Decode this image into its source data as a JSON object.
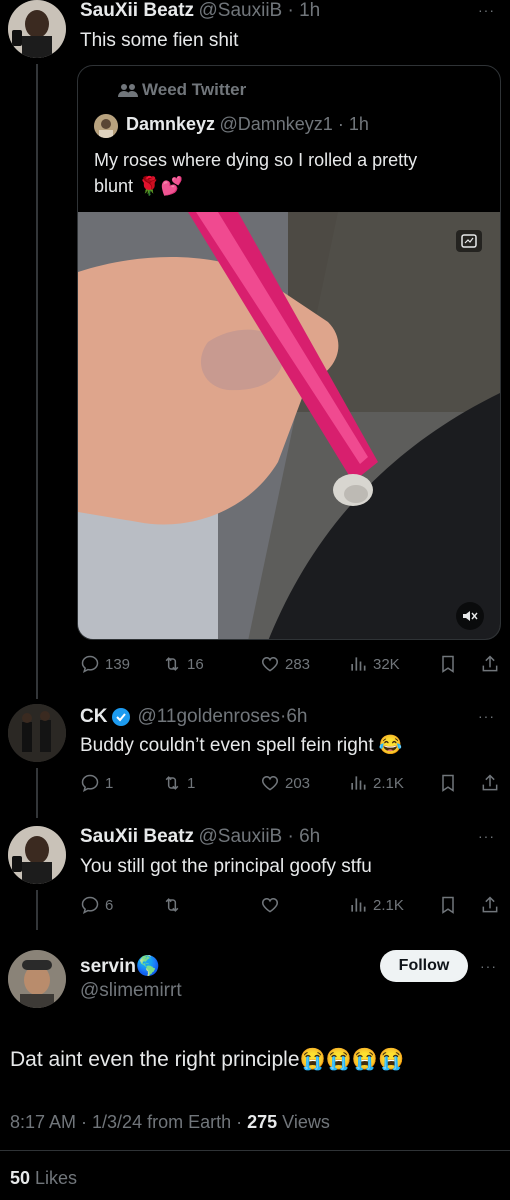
{
  "main_tweet": {
    "author_name": "SauXii Beatz",
    "handle": "@SauxiiB",
    "time": "1h",
    "text": "This some fien shit",
    "more": "···"
  },
  "quoted_tweet": {
    "community": "Weed Twitter",
    "author_name": "Damnkeyz",
    "handle": "@Damnkeyz1",
    "time": "1h",
    "text_line1": "My roses where dying so I rolled a pretty",
    "text_line2": "blunt 🌹💕"
  },
  "main_actions": {
    "replies": "139",
    "reposts": "16",
    "likes": "283",
    "views": "32K"
  },
  "reply1": {
    "author_name": "CK",
    "handle": "@11goldenroses",
    "time": "6h",
    "text": "Buddy couldn’t even spell fein right 😂",
    "actions": {
      "replies": "1",
      "reposts": "1",
      "likes": "203",
      "views": "2.1K"
    },
    "more": "···"
  },
  "reply2": {
    "author_name": "SauXii Beatz",
    "handle": "@SauxiiB",
    "time": "6h",
    "text": "You still got the principal goofy stfu",
    "actions": {
      "replies": "6",
      "reposts": "",
      "likes": "",
      "views": "2.1K"
    },
    "more": "···"
  },
  "focused": {
    "author_name": "servin🌎",
    "handle": "@slimemirrt",
    "follow_label": "Follow",
    "more": "···",
    "text": "Dat aint even the right principle😭😭😭😭",
    "meta_prefix": "8:17 AM · 1/3/24 from Earth · ",
    "views_count": "275",
    "views_label": " Views",
    "likes_count": "50",
    "likes_label": " Likes"
  },
  "colors": {
    "background": "#000000",
    "text": "#e7e9ea",
    "muted": "#71767b",
    "verified": "#1d9bf0",
    "border": "#2f3336"
  }
}
